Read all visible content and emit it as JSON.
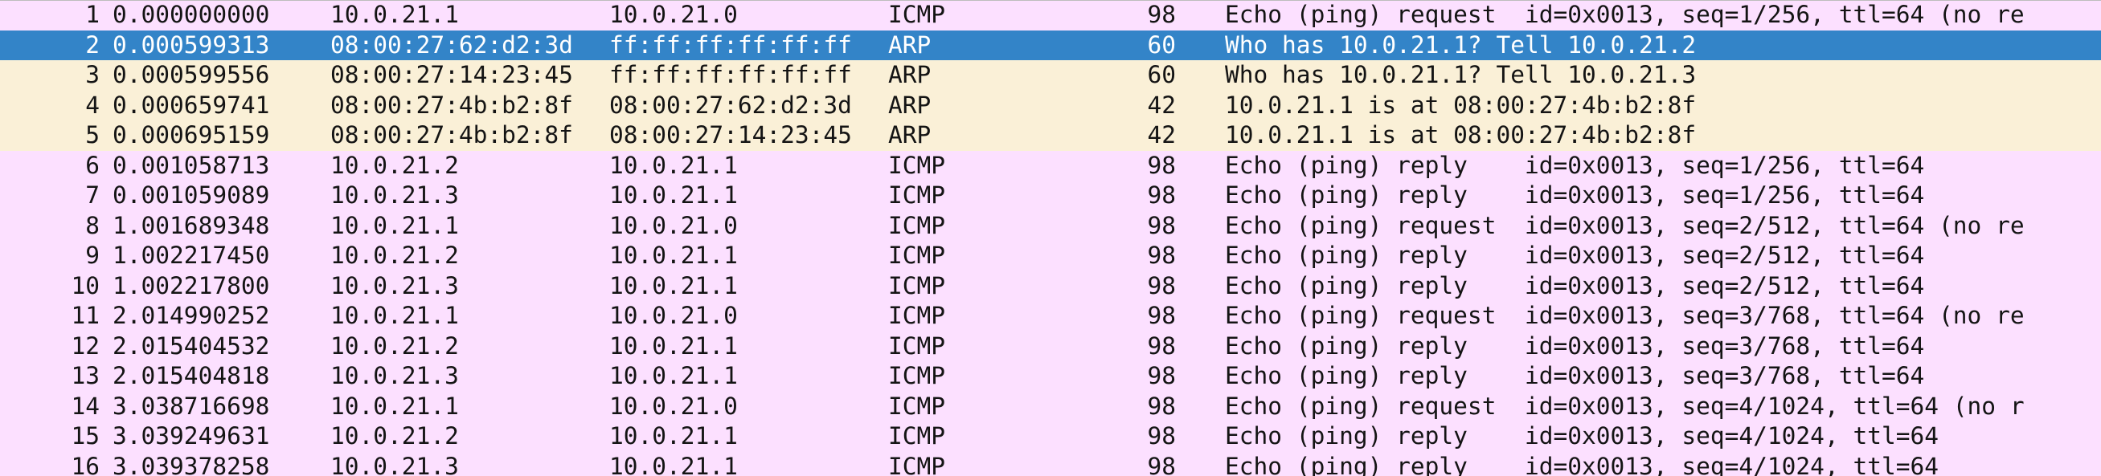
{
  "colors": {
    "icmp_row": "#fce0ff",
    "arp_row": "#faf0d7",
    "selected_row": "#3384c8",
    "selected_text": "#ffffff",
    "text": "#141414"
  },
  "packets": [
    {
      "no": "1",
      "time": "0.000000000",
      "source": "10.0.21.1",
      "destination": "10.0.21.0",
      "protocol": "ICMP",
      "length": "98",
      "info": "Echo (ping) request  id=0x0013, seq=1/256, ttl=64 (no re"
    },
    {
      "no": "2",
      "time": "0.000599313",
      "source": "08:00:27:62:d2:3d",
      "destination": "ff:ff:ff:ff:ff:ff",
      "protocol": "ARP",
      "length": "60",
      "info": "Who has 10.0.21.1? Tell 10.0.21.2"
    },
    {
      "no": "3",
      "time": "0.000599556",
      "source": "08:00:27:14:23:45",
      "destination": "ff:ff:ff:ff:ff:ff",
      "protocol": "ARP",
      "length": "60",
      "info": "Who has 10.0.21.1? Tell 10.0.21.3"
    },
    {
      "no": "4",
      "time": "0.000659741",
      "source": "08:00:27:4b:b2:8f",
      "destination": "08:00:27:62:d2:3d",
      "protocol": "ARP",
      "length": "42",
      "info": "10.0.21.1 is at 08:00:27:4b:b2:8f"
    },
    {
      "no": "5",
      "time": "0.000695159",
      "source": "08:00:27:4b:b2:8f",
      "destination": "08:00:27:14:23:45",
      "protocol": "ARP",
      "length": "42",
      "info": "10.0.21.1 is at 08:00:27:4b:b2:8f"
    },
    {
      "no": "6",
      "time": "0.001058713",
      "source": "10.0.21.2",
      "destination": "10.0.21.1",
      "protocol": "ICMP",
      "length": "98",
      "info": "Echo (ping) reply    id=0x0013, seq=1/256, ttl=64"
    },
    {
      "no": "7",
      "time": "0.001059089",
      "source": "10.0.21.3",
      "destination": "10.0.21.1",
      "protocol": "ICMP",
      "length": "98",
      "info": "Echo (ping) reply    id=0x0013, seq=1/256, ttl=64"
    },
    {
      "no": "8",
      "time": "1.001689348",
      "source": "10.0.21.1",
      "destination": "10.0.21.0",
      "protocol": "ICMP",
      "length": "98",
      "info": "Echo (ping) request  id=0x0013, seq=2/512, ttl=64 (no re"
    },
    {
      "no": "9",
      "time": "1.002217450",
      "source": "10.0.21.2",
      "destination": "10.0.21.1",
      "protocol": "ICMP",
      "length": "98",
      "info": "Echo (ping) reply    id=0x0013, seq=2/512, ttl=64"
    },
    {
      "no": "10",
      "time": "1.002217800",
      "source": "10.0.21.3",
      "destination": "10.0.21.1",
      "protocol": "ICMP",
      "length": "98",
      "info": "Echo (ping) reply    id=0x0013, seq=2/512, ttl=64"
    },
    {
      "no": "11",
      "time": "2.014990252",
      "source": "10.0.21.1",
      "destination": "10.0.21.0",
      "protocol": "ICMP",
      "length": "98",
      "info": "Echo (ping) request  id=0x0013, seq=3/768, ttl=64 (no re"
    },
    {
      "no": "12",
      "time": "2.015404532",
      "source": "10.0.21.2",
      "destination": "10.0.21.1",
      "protocol": "ICMP",
      "length": "98",
      "info": "Echo (ping) reply    id=0x0013, seq=3/768, ttl=64"
    },
    {
      "no": "13",
      "time": "2.015404818",
      "source": "10.0.21.3",
      "destination": "10.0.21.1",
      "protocol": "ICMP",
      "length": "98",
      "info": "Echo (ping) reply    id=0x0013, seq=3/768, ttl=64"
    },
    {
      "no": "14",
      "time": "3.038716698",
      "source": "10.0.21.1",
      "destination": "10.0.21.0",
      "protocol": "ICMP",
      "length": "98",
      "info": "Echo (ping) request  id=0x0013, seq=4/1024, ttl=64 (no r"
    },
    {
      "no": "15",
      "time": "3.039249631",
      "source": "10.0.21.2",
      "destination": "10.0.21.1",
      "protocol": "ICMP",
      "length": "98",
      "info": "Echo (ping) reply    id=0x0013, seq=4/1024, ttl=64"
    },
    {
      "no": "16",
      "time": "3.039378258",
      "source": "10.0.21.3",
      "destination": "10.0.21.1",
      "protocol": "ICMP",
      "length": "98",
      "info": "Echo (ping) reply    id=0x0013, seq=4/1024, ttl=64"
    }
  ]
}
